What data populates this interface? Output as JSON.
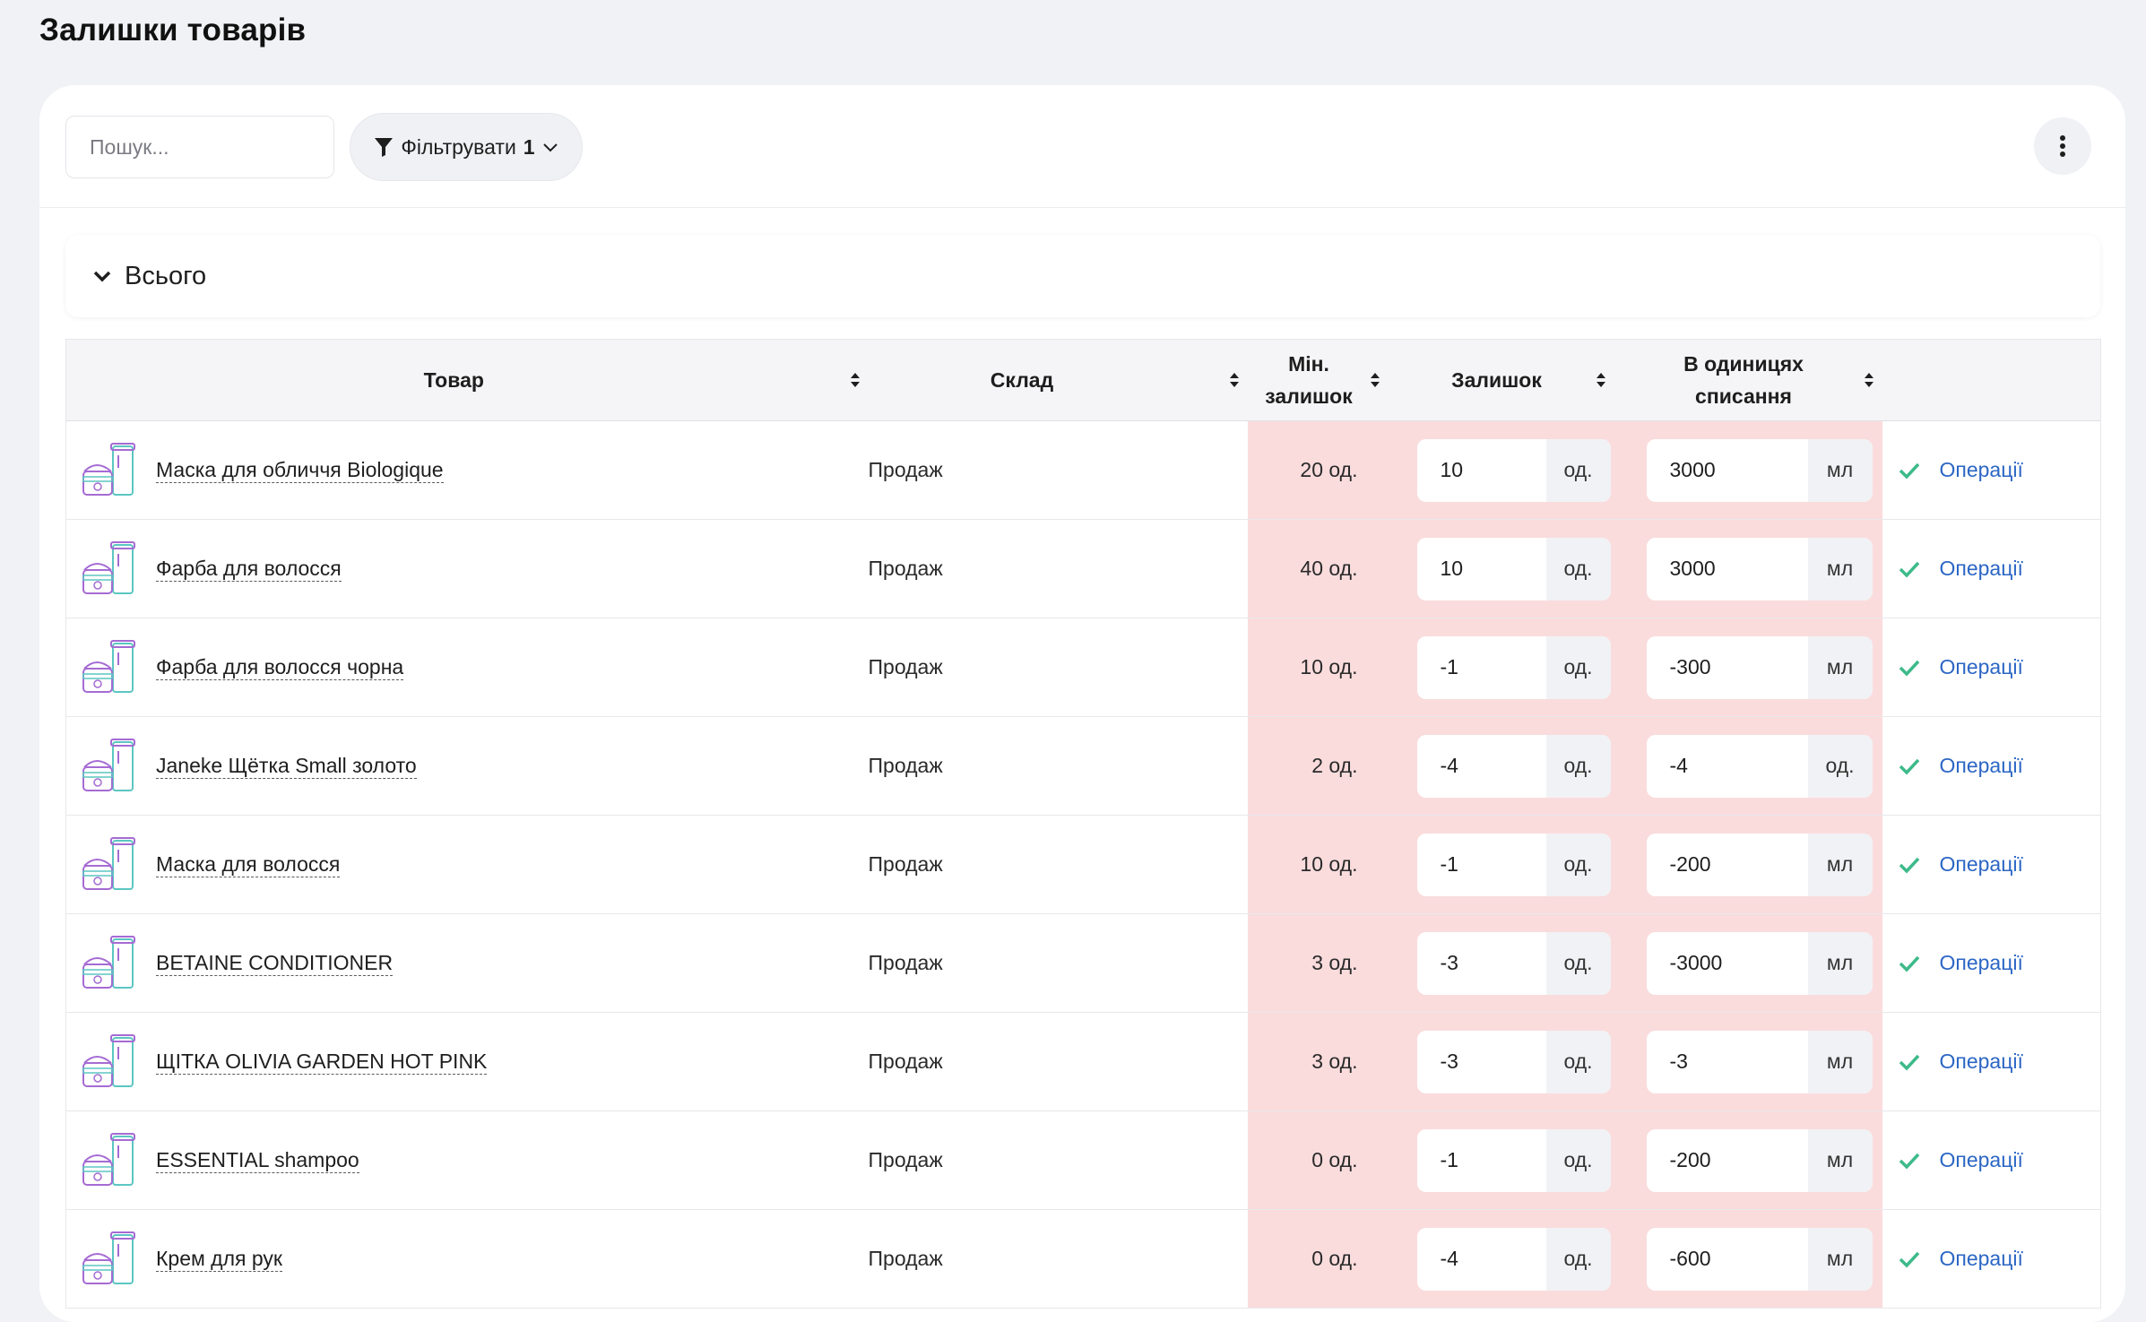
{
  "page": {
    "title": "Залишки товарів"
  },
  "toolbar": {
    "search_placeholder": "Пошук...",
    "filter_label": "Фільтрувати",
    "filter_count": "1"
  },
  "total": {
    "label": "Всього"
  },
  "table": {
    "columns": {
      "product": "Товар",
      "warehouse": "Склад",
      "min_line1": "Мін.",
      "min_line2": "залишок",
      "stock": "Залишок",
      "writeoff_line1": "В одиницях",
      "writeoff_line2": "списання"
    },
    "rows": [
      {
        "name": "Маска для обличчя Biologique",
        "warehouse": "Продаж",
        "min": "20 од.",
        "qty": "10",
        "qty_unit": "од.",
        "wr": "3000",
        "wr_unit": "мл",
        "ops": "Операції"
      },
      {
        "name": "Фарба для волосся",
        "warehouse": "Продаж",
        "min": "40 од.",
        "qty": "10",
        "qty_unit": "од.",
        "wr": "3000",
        "wr_unit": "мл",
        "ops": "Операції"
      },
      {
        "name": "Фарба для волосся чорна",
        "warehouse": "Продаж",
        "min": "10 од.",
        "qty": "-1",
        "qty_unit": "од.",
        "wr": "-300",
        "wr_unit": "мл",
        "ops": "Операції"
      },
      {
        "name": "Janeke Щётка Small золото",
        "warehouse": "Продаж",
        "min": "2 од.",
        "qty": "-4",
        "qty_unit": "од.",
        "wr": "-4",
        "wr_unit": "од.",
        "ops": "Операції"
      },
      {
        "name": "Маска для волосся",
        "warehouse": "Продаж",
        "min": "10 од.",
        "qty": "-1",
        "qty_unit": "од.",
        "wr": "-200",
        "wr_unit": "мл",
        "ops": "Операції"
      },
      {
        "name": "BETAINE CONDITIONER",
        "warehouse": "Продаж",
        "min": "3 од.",
        "qty": "-3",
        "qty_unit": "од.",
        "wr": "-3000",
        "wr_unit": "мл",
        "ops": "Операції"
      },
      {
        "name": "ЩІТКА OLIVIA GARDEN HOT PINK",
        "warehouse": "Продаж",
        "min": "3 од.",
        "qty": "-3",
        "qty_unit": "од.",
        "wr": "-3",
        "wr_unit": "мл",
        "ops": "Операції"
      },
      {
        "name": "ESSENTIAL shampoo",
        "warehouse": "Продаж",
        "min": "0 од.",
        "qty": "-1",
        "qty_unit": "од.",
        "wr": "-200",
        "wr_unit": "мл",
        "ops": "Операції"
      },
      {
        "name": "Крем для рук",
        "warehouse": "Продаж",
        "min": "0 од.",
        "qty": "-4",
        "qty_unit": "од.",
        "wr": "-600",
        "wr_unit": "мл",
        "ops": "Операції"
      }
    ]
  },
  "colors": {
    "low_stock_bg": "#fadcdd",
    "link": "#2b66c4",
    "check": "#3dba8a",
    "icon_purple": "#a56bd3",
    "icon_teal": "#5cc6c2"
  }
}
